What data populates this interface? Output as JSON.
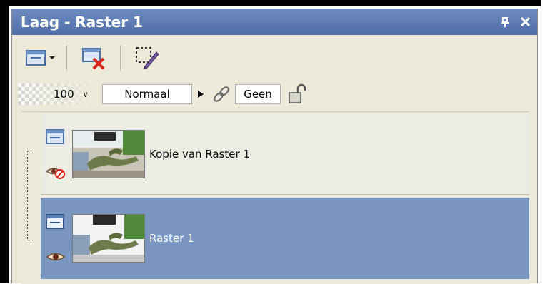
{
  "palette": {
    "title": "Laag - Raster 1",
    "pin_glyph": "ↀ",
    "close_glyph": "✕"
  },
  "toolbar": {
    "icons": [
      "new-layer-icon",
      "delete-layer-icon",
      "edit-selection-icon"
    ]
  },
  "properties": {
    "opacity": "100",
    "opacity_spin": "∨",
    "blend_mode": "Normaal",
    "group": "Geen"
  },
  "layers": [
    {
      "name": "Kopie van Raster 1",
      "visible": false,
      "selected": false
    },
    {
      "name": "Raster 1",
      "visible": true,
      "selected": true
    }
  ],
  "colors": {
    "titlebar": "#5874a8",
    "selected_row": "#7896c0",
    "panel_bg": "#ece9d8"
  }
}
